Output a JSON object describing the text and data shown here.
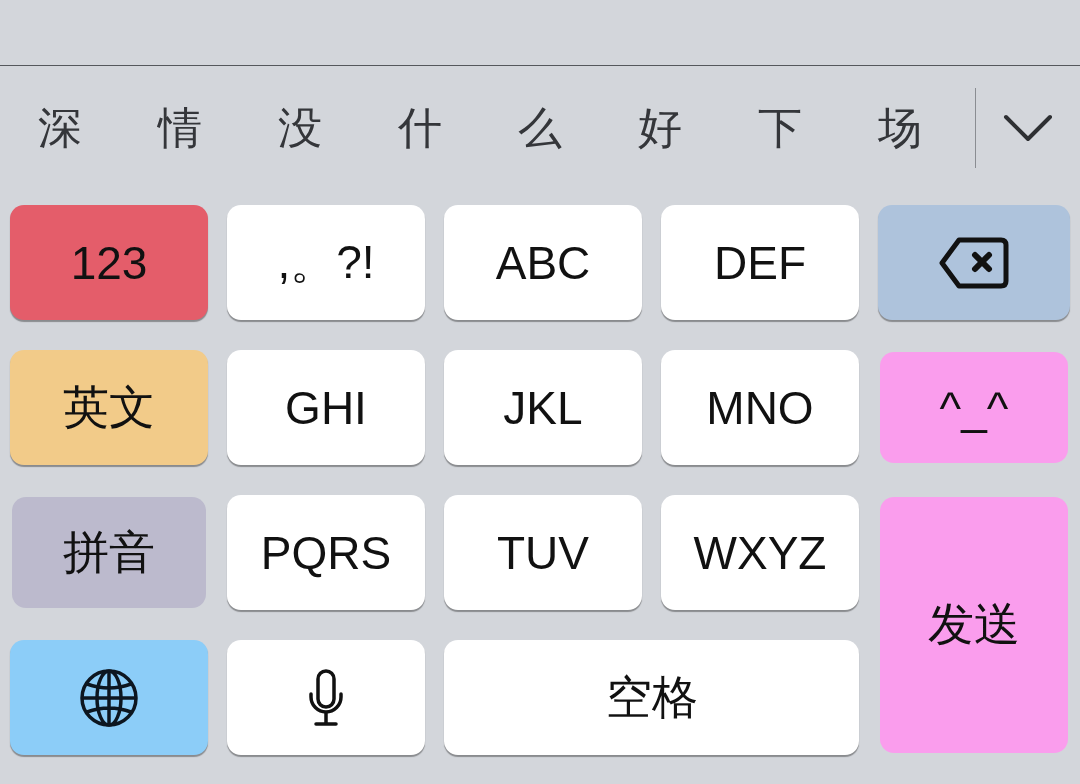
{
  "candidate_bar": {
    "candidates": [
      "深",
      "情",
      "没",
      "什",
      "么",
      "好",
      "下",
      "场"
    ]
  },
  "keys": [
    {
      "kind": "text",
      "label": "123",
      "color": "#e45d6a",
      "raised": true
    },
    {
      "kind": "text",
      "label": ",。?!",
      "color": "#ffffff",
      "raised": true
    },
    {
      "kind": "text",
      "label": "ABC",
      "color": "#ffffff",
      "raised": true
    },
    {
      "kind": "text",
      "label": "DEF",
      "color": "#ffffff",
      "raised": true
    },
    {
      "kind": "backspace",
      "color": "#aec3dc",
      "raised": true
    },
    {
      "kind": "text",
      "label": "英文",
      "color": "#f2cb89",
      "raised": true
    },
    {
      "kind": "text",
      "label": "GHI",
      "color": "#ffffff",
      "raised": true
    },
    {
      "kind": "text",
      "label": "JKL",
      "color": "#ffffff",
      "raised": true
    },
    {
      "kind": "text",
      "label": "MNO",
      "color": "#ffffff",
      "raised": true
    },
    {
      "kind": "text",
      "label": "^_^",
      "color": "#fa9ded",
      "raised": false
    },
    {
      "kind": "text",
      "label": "拼音",
      "color": "#bcbacd",
      "raised": false
    },
    {
      "kind": "text",
      "label": "PQRS",
      "color": "#ffffff",
      "raised": true
    },
    {
      "kind": "text",
      "label": "TUV",
      "color": "#ffffff",
      "raised": true
    },
    {
      "kind": "text",
      "label": "WXYZ",
      "color": "#ffffff",
      "raised": true
    },
    {
      "kind": "send",
      "label": "发送",
      "color": "#fa9ded",
      "raised": false
    },
    {
      "kind": "globe",
      "color": "#8ccdf8",
      "raised": true
    },
    {
      "kind": "mic",
      "color": "#ffffff",
      "raised": true
    },
    {
      "kind": "space",
      "label": "空格",
      "color": "#ffffff",
      "raised": true
    }
  ]
}
